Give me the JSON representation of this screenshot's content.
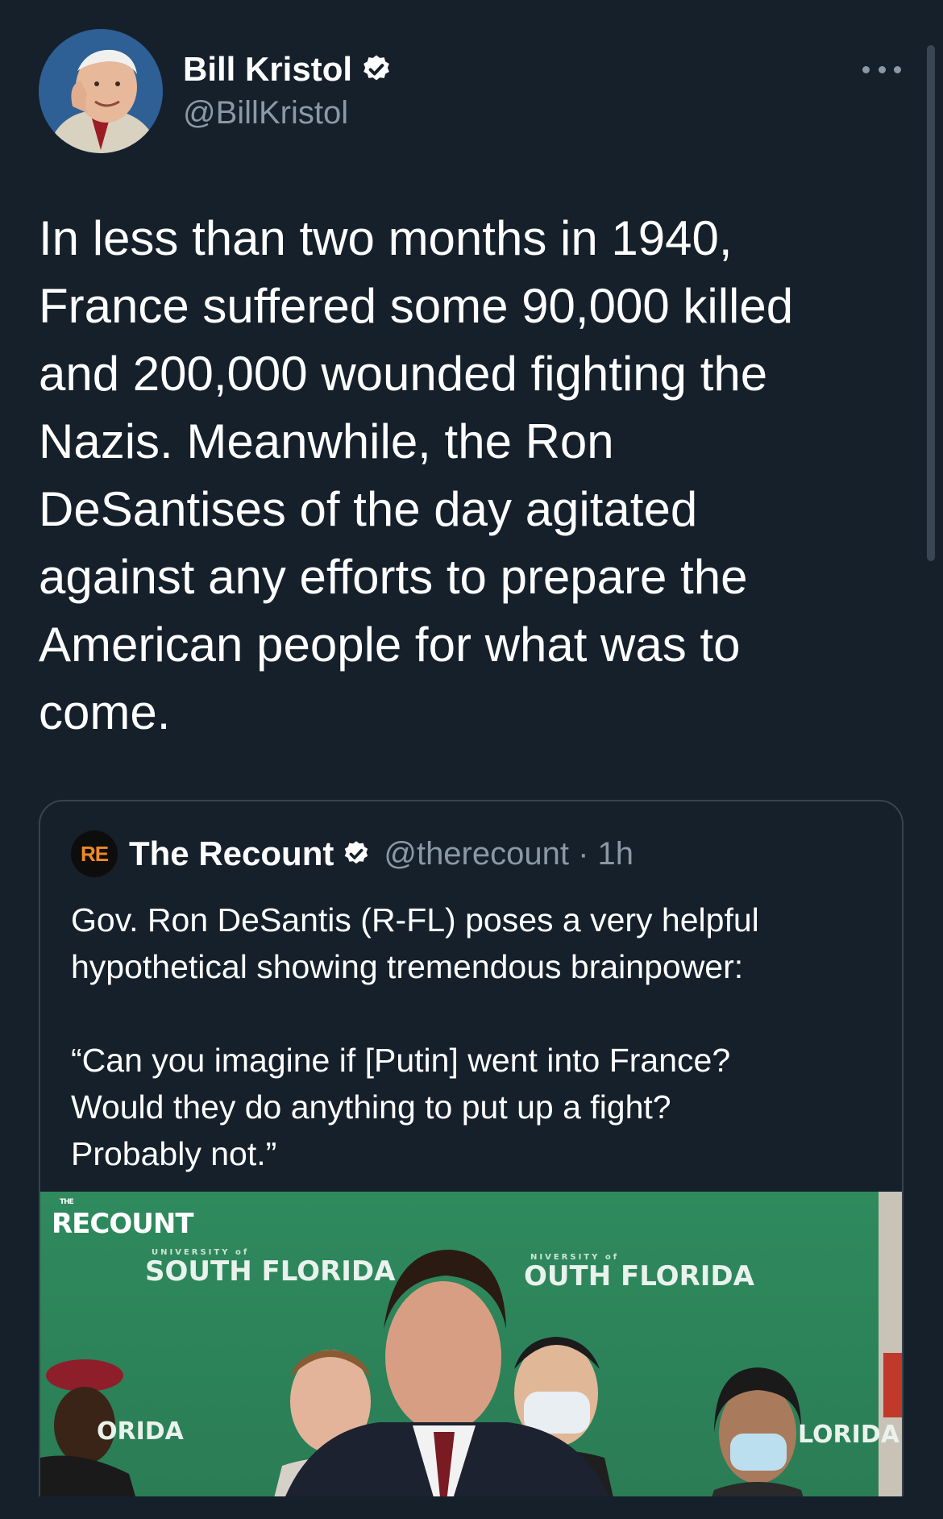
{
  "author": {
    "name": "Bill Kristol",
    "handle": "@BillKristol"
  },
  "tweet": {
    "text": "In less than two months in 1940,\nFrance suffered some 90,000 killed\nand 200,000 wounded fighting the\nNazis. Meanwhile, the Ron\nDeSantises of the day agitated\nagainst any efforts to prepare the\nAmerican people for what was to\ncome."
  },
  "quote": {
    "logo_text": "RE",
    "name": "The Recount",
    "handle_time": "@therecount · 1h",
    "text": "Gov. Ron DeSantis (R-FL) poses a very helpful\nhypothetical showing tremendous brainpower:\n\n“Can you imagine if [Putin] went into France?\nWould they do anything to put up a fight?\nProbably not.”",
    "media": {
      "brand": "RECOUNT",
      "brand_small": "THE",
      "banner_left_small": "UNIVERSITY of",
      "banner_left": "SOUTH FLORIDA",
      "banner_right_small": "NIVERSITY of",
      "banner_right": "OUTH FLORIDA",
      "banner_low_left": "ORIDA",
      "banner_low_right": "LORIDA"
    }
  },
  "colors": {
    "background": "#15202b",
    "secondary_text": "#8b98a5",
    "verified": "#ffffff",
    "card_border": "#38444d"
  }
}
